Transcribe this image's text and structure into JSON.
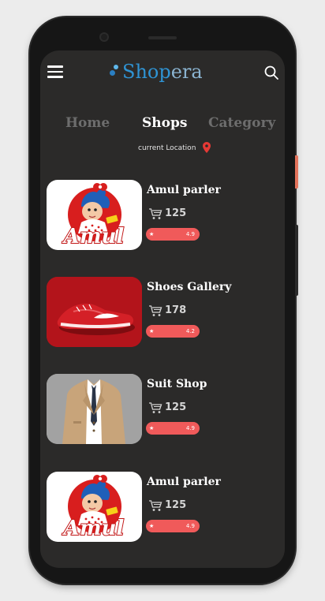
{
  "header": {
    "brand": "Shopera",
    "brand_part1": "Shop",
    "brand_part2": "era"
  },
  "tabs": [
    {
      "label": "Home",
      "active": false
    },
    {
      "label": "Shops",
      "active": true
    },
    {
      "label": "Category",
      "active": false
    }
  ],
  "location": {
    "text": "current Location"
  },
  "shops": [
    {
      "name": "Amul parler",
      "count": "125",
      "rating": "4.9",
      "rating_fraction": 0.98,
      "image": "amul-logo"
    },
    {
      "name": "Shoes Gallery",
      "count": "178",
      "rating": "4.2",
      "rating_fraction": 0.84,
      "image": "red-sneaker"
    },
    {
      "name": "Suit Shop",
      "count": "125",
      "rating": "4.9",
      "rating_fraction": 0.98,
      "image": "man-in-suit"
    },
    {
      "name": "Amul parler",
      "count": "125",
      "rating": "4.9",
      "rating_fraction": 0.98,
      "image": "amul-logo"
    }
  ],
  "icons": {
    "menu": "hamburger-menu-icon",
    "search": "search-icon",
    "location": "map-pin-icon",
    "cart": "shopping-cart-icon",
    "star": "star-icon"
  },
  "colors": {
    "screen_bg": "#2b2a29",
    "brand_blue": "#2f93d3",
    "rating_red": "#f05a5a",
    "pin_red": "#e53935",
    "tab_active": "#ffffff",
    "tab_inactive": "#6d6d6d"
  }
}
